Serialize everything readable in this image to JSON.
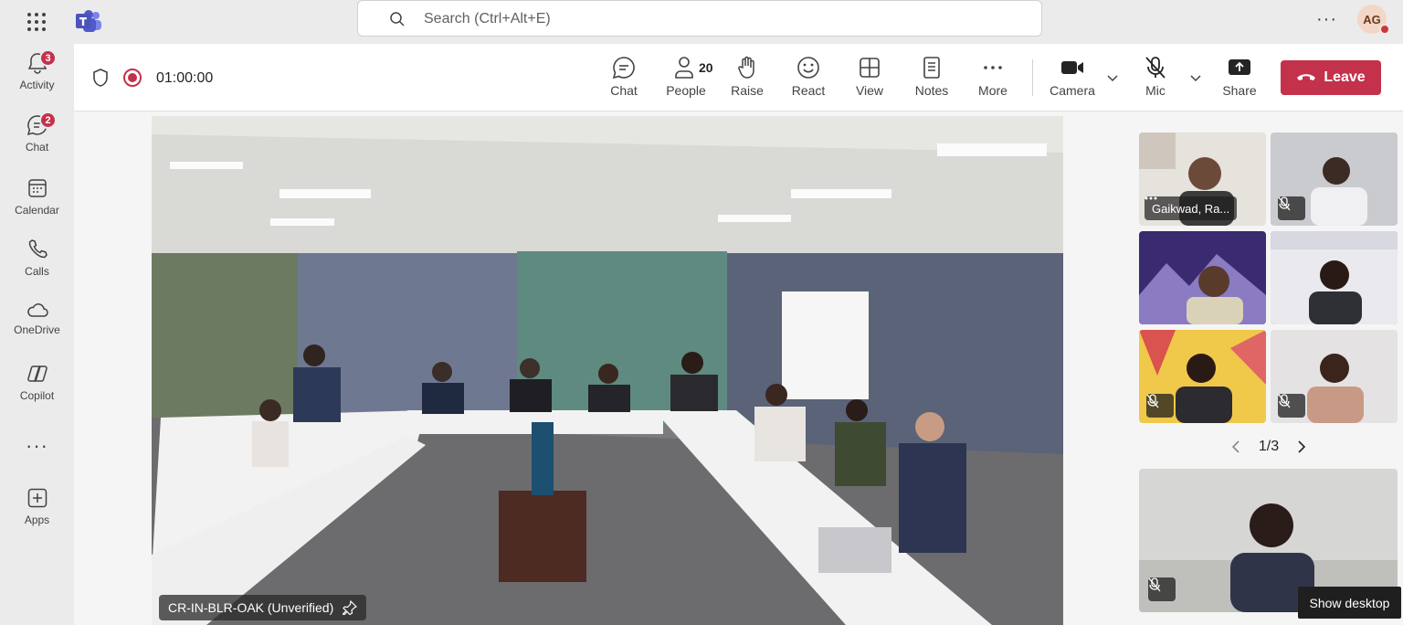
{
  "topbar": {
    "search_placeholder": "Search (Ctrl+Alt+E)",
    "user_initials": "AG",
    "more_glyph": "···"
  },
  "rail": {
    "items": [
      {
        "label": "Activity",
        "badge": "3",
        "icon": "bell-icon"
      },
      {
        "label": "Chat",
        "badge": "2",
        "icon": "chat-icon"
      },
      {
        "label": "Calendar",
        "icon": "calendar-icon"
      },
      {
        "label": "Calls",
        "icon": "phone-icon"
      },
      {
        "label": "OneDrive",
        "icon": "cloud-icon"
      },
      {
        "label": "Copilot",
        "icon": "copilot-icon"
      },
      {
        "label": "Apps",
        "icon": "add-app-icon"
      }
    ],
    "more_glyph": "···"
  },
  "meeting": {
    "timer": "01:00:00",
    "people_count": "20",
    "buttons": {
      "chat": "Chat",
      "people": "People",
      "raise": "Raise",
      "react": "React",
      "view": "View",
      "notes": "Notes",
      "more": "More",
      "camera": "Camera",
      "mic": "Mic",
      "share": "Share",
      "leave": "Leave"
    }
  },
  "stage": {
    "main_participant": "CR-IN-BLR-OAK (Unverified)",
    "tile_name": "Gaikwad, Ra...",
    "pager": "1/3",
    "tooltip": "Show desktop"
  },
  "colors": {
    "accent": "#5b5fc7",
    "leave": "#c4314b",
    "badge": "#c4314b"
  }
}
